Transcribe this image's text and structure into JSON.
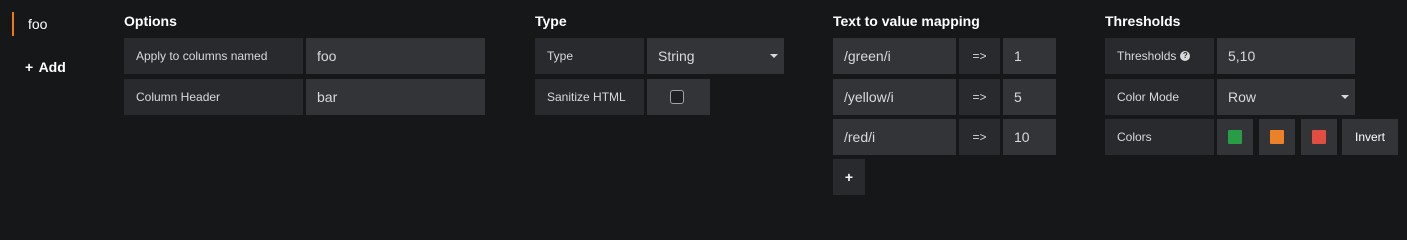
{
  "styles": {
    "items": [
      {
        "label": "foo"
      }
    ],
    "add_label": "Add"
  },
  "options": {
    "title": "Options",
    "apply_label": "Apply to columns named",
    "apply_value": "foo",
    "header_label": "Column Header",
    "header_value": "bar"
  },
  "type_section": {
    "title": "Type",
    "type_label": "Type",
    "type_value": "String",
    "sanitize_label": "Sanitize HTML",
    "sanitize_checked": false
  },
  "mapping": {
    "title": "Text to value mapping",
    "arrow": "=>",
    "rows": [
      {
        "text": "/green/i",
        "value": "1"
      },
      {
        "text": "/yellow/i",
        "value": "5"
      },
      {
        "text": "/red/i",
        "value": "10"
      }
    ],
    "add_label": "+"
  },
  "thresholds": {
    "title": "Thresholds",
    "thresholds_label": "Thresholds",
    "thresholds_value": "5,10",
    "color_mode_label": "Color Mode",
    "color_mode_value": "Row",
    "colors_label": "Colors",
    "colors": [
      "#299c46",
      "#ed8128",
      "#e24d42"
    ],
    "invert_label": "Invert"
  },
  "icons": {
    "plus": "plus-icon",
    "help": "question-circle-icon",
    "caret": "caret-down-icon"
  }
}
